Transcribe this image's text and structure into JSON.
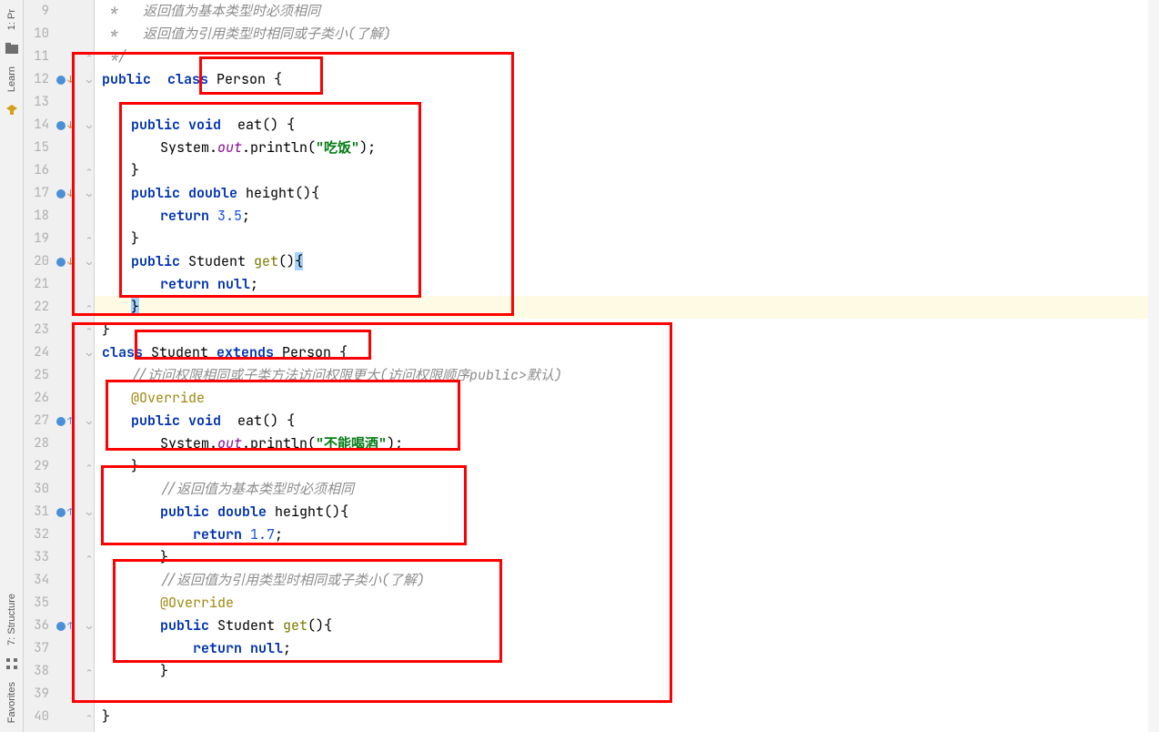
{
  "toolbar": {
    "project": "1: Pr",
    "learn": "Learn",
    "structure": "7: Structure",
    "favorites": "Favorites"
  },
  "lines": {
    "9": {
      "num": "9"
    },
    "10": {
      "num": "10"
    },
    "11": {
      "num": "11"
    },
    "12": {
      "num": "12"
    },
    "13": {
      "num": "13"
    },
    "14": {
      "num": "14"
    },
    "15": {
      "num": "15"
    },
    "16": {
      "num": "16"
    },
    "17": {
      "num": "17"
    },
    "18": {
      "num": "18"
    },
    "19": {
      "num": "19"
    },
    "20": {
      "num": "20"
    },
    "21": {
      "num": "21"
    },
    "22": {
      "num": "22"
    },
    "23": {
      "num": "23"
    },
    "24": {
      "num": "24"
    },
    "25": {
      "num": "25"
    },
    "26": {
      "num": "26"
    },
    "27": {
      "num": "27"
    },
    "28": {
      "num": "28"
    },
    "29": {
      "num": "29"
    },
    "30": {
      "num": "30"
    },
    "31": {
      "num": "31"
    },
    "32": {
      "num": "32"
    },
    "33": {
      "num": "33"
    },
    "34": {
      "num": "34"
    },
    "35": {
      "num": "35"
    },
    "36": {
      "num": "36"
    },
    "37": {
      "num": "37"
    },
    "38": {
      "num": "38"
    },
    "39": {
      "num": "39"
    },
    "40": {
      "num": "40"
    }
  },
  "code": {
    "l9_cmt": " *   返回值为基本类型时必须相同",
    "l10_cmt": " *   返回值为引用类型时相同或子类小(了解)",
    "l11_cmt": " */",
    "l12_public": "public",
    "l12_class": "class",
    "l12_person": " Person {",
    "l14_public": "public",
    "l14_void": "void",
    "l14_eat": "  eat",
    "l14_paren": "() {",
    "l15_sys": "System.",
    "l15_out": "out",
    "l15_println": ".println(",
    "l15_str": "\"吃饭\"",
    "l15_end": ");",
    "l16_brace": "}",
    "l17_public": "public",
    "l17_double": "double",
    "l17_height": " height",
    "l17_paren": "(){",
    "l18_return": "return",
    "l18_num": " 3.5",
    "l18_semi": ";",
    "l19_brace": "}",
    "l20_public": "public",
    "l20_student": " Student ",
    "l20_get": "get",
    "l20_paren": "()",
    "l20_brace": "{",
    "l21_return": "return",
    "l21_null": " null",
    "l21_semi": ";",
    "l22_brace": "}",
    "l23_brace": "}",
    "l24_class": "class",
    "l24_student": " Student ",
    "l24_extends": "extends",
    "l24_person": " Person {",
    "l25_cmt": "//访问权限相同或子类方法访问权限更大(访问权限顺序public>默认)",
    "l26_anno": "@Override",
    "l27_public": "public",
    "l27_void": "void",
    "l27_eat": "  eat",
    "l27_paren": "() {",
    "l28_sys": "System.",
    "l28_out": "out",
    "l28_println": ".println(",
    "l28_str": "\"不能喝酒\"",
    "l28_end": ");",
    "l29_brace": "}",
    "l30_cmt": "//返回值为基本类型时必须相同",
    "l31_public": "public",
    "l31_double": "double",
    "l31_height": " height",
    "l31_paren": "(){",
    "l32_return": "return",
    "l32_num": " 1.7",
    "l32_semi": ";",
    "l33_brace": "}",
    "l34_cmt": "//返回值为引用类型时相同或子类小(了解)",
    "l35_anno": "@Override",
    "l36_public": "public",
    "l36_student": " Student ",
    "l36_get": "get",
    "l36_paren": "(){",
    "l37_return": "return",
    "l37_null": " null",
    "l37_semi": ";",
    "l38_brace": "}",
    "l40_brace": "}"
  }
}
